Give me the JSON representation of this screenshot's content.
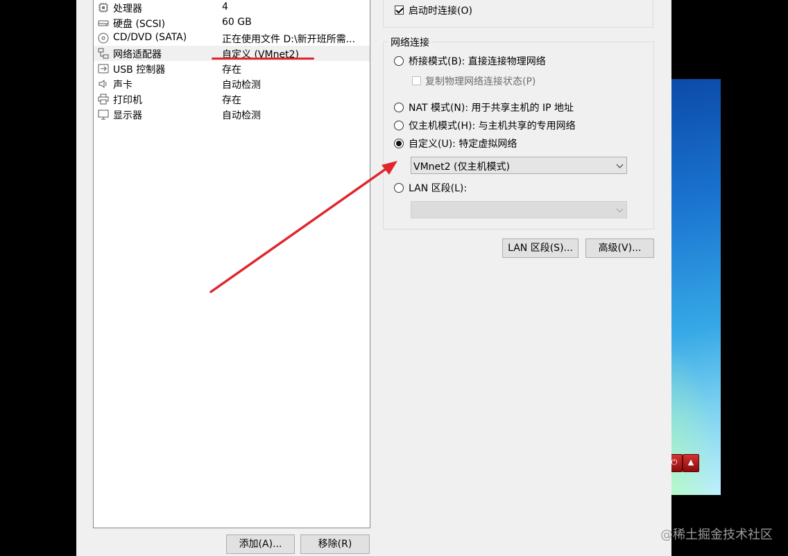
{
  "devices": [
    {
      "name": "处理器",
      "summary": "4",
      "icon": "cpu-icon"
    },
    {
      "name": "硬盘 (SCSI)",
      "summary": "60 GB",
      "icon": "hard-disk-icon"
    },
    {
      "name": "CD/DVD (SATA)",
      "summary": "正在使用文件 D:\\新开班所需...",
      "icon": "cd-dvd-icon"
    },
    {
      "name": "网络适配器",
      "summary": "自定义 (VMnet2)",
      "icon": "network-adapter-icon"
    },
    {
      "name": "USB 控制器",
      "summary": "存在",
      "icon": "usb-icon"
    },
    {
      "name": "声卡",
      "summary": "自动检测",
      "icon": "speaker-icon"
    },
    {
      "name": "打印机",
      "summary": "存在",
      "icon": "printer-icon"
    },
    {
      "name": "显示器",
      "summary": "自动检测",
      "icon": "monitor-icon"
    }
  ],
  "device_buttons": {
    "add": "添加(A)...",
    "remove": "移除(R)"
  },
  "device_status": {
    "connect_at_power_on": "启动时连接(O)"
  },
  "network": {
    "group_title": "网络连接",
    "bridged": "桥接模式(B): 直接连接物理网络",
    "replicate": "复制物理网络连接状态(P)",
    "nat": "NAT 模式(N): 用于共享主机的 IP 地址",
    "host_only": "仅主机模式(H): 与主机共享的专用网络",
    "custom": "自定义(U): 特定虚拟网络",
    "custom_value": "VMnet2 (仅主机模式)",
    "lan": "LAN 区段(L):",
    "lan_value": ""
  },
  "bottom_buttons": {
    "lan_segments": "LAN 区段(S)...",
    "advanced": "高级(V)..."
  },
  "watermark": "@稀土掘金技术社区",
  "colors": {
    "annotation": "#e0262c"
  }
}
